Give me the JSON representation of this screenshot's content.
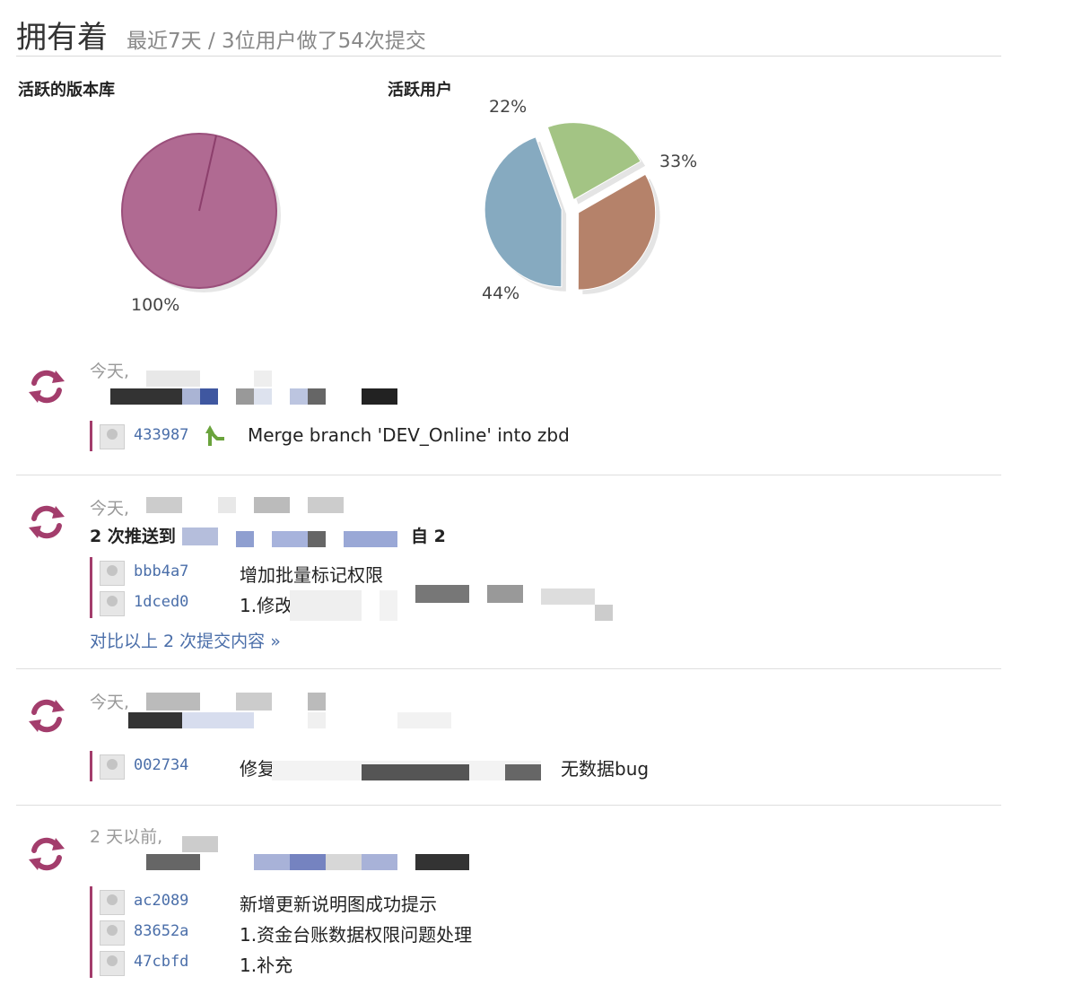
{
  "header": {
    "title": "拥有着",
    "subtitle": "最近7天 / 3位用户做了54次提交"
  },
  "charts": {
    "repos_label": "活跃的版本库",
    "users_label": "活跃用户",
    "repos_percentage": "100%",
    "users_percentages": [
      "22%",
      "33%",
      "44%"
    ]
  },
  "chart_data": [
    {
      "type": "pie",
      "title": "活跃的版本库",
      "values": [
        100
      ],
      "colors": [
        "#b06a92"
      ]
    },
    {
      "type": "pie",
      "title": "活跃用户",
      "values": [
        22,
        33,
        44
      ],
      "colors": [
        "#a3c484",
        "#b5826a",
        "#86aac0"
      ]
    }
  ],
  "events": [
    {
      "time": "今天,",
      "title": "",
      "commits": [
        {
          "sha": "433987",
          "message": "Merge branch 'DEV_Online' into zbd"
        }
      ]
    },
    {
      "time": "今天,",
      "title_prefix": "2 次推送到",
      "title_suffix": "自 2",
      "commits": [
        {
          "sha": "bbb4a7",
          "message": "增加批量标记权限"
        },
        {
          "sha": "1dced0",
          "message": "1.修改"
        }
      ],
      "compare_link": "对比以上 2 次提交内容 »"
    },
    {
      "time": "今天,",
      "title": "",
      "commits": [
        {
          "sha": "002734",
          "message_prefix": "修复",
          "message_suffix": "无数据bug"
        }
      ]
    },
    {
      "time": "2 天以前,",
      "title": "",
      "commits": [
        {
          "sha": "ac2089",
          "message": "新增更新说明图成功提示"
        },
        {
          "sha": "83652a",
          "message": "1.资金台账数据权限问题处理"
        },
        {
          "sha": "47cbfd",
          "message": "1.补充"
        }
      ]
    }
  ],
  "colors": {
    "accent": "#a33d6c",
    "link": "#4a6ea9"
  },
  "icons": {
    "event": "refresh-cycle-icon",
    "merge": "merge-arrow-icon"
  }
}
